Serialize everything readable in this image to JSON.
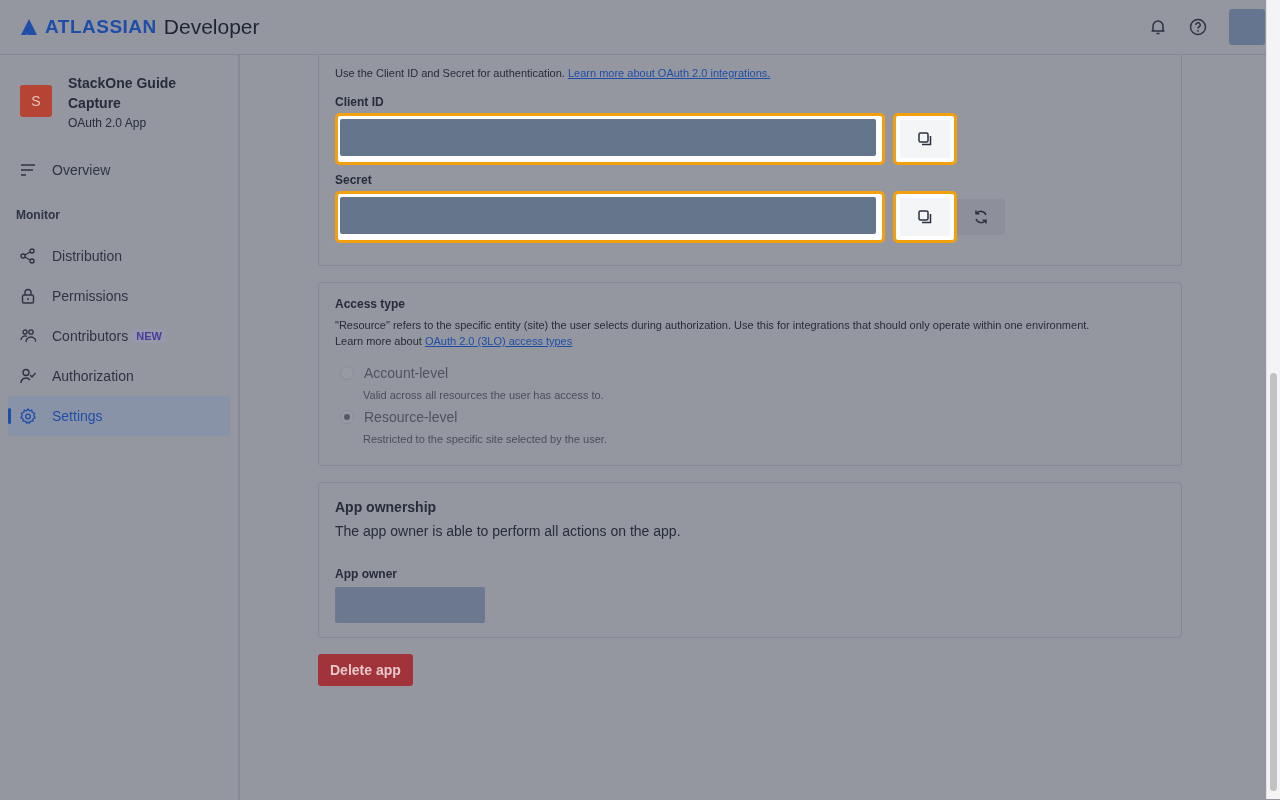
{
  "header": {
    "brand": "ATLASSIAN",
    "product": "Developer"
  },
  "app": {
    "initial": "S",
    "name": "StackOne Guide Capture",
    "type": "OAuth 2.0 App"
  },
  "nav": [
    {
      "kind": "item",
      "label": "Overview",
      "selected": false
    },
    {
      "kind": "heading",
      "label": "Monitor"
    },
    {
      "kind": "item",
      "label": "Distribution",
      "selected": false
    },
    {
      "kind": "item",
      "label": "Permissions",
      "selected": false
    },
    {
      "kind": "item",
      "label": "Contributors",
      "badge": "NEW",
      "selected": false
    },
    {
      "kind": "item",
      "label": "Authorization",
      "selected": false
    },
    {
      "kind": "item",
      "label": "Settings",
      "selected": true
    }
  ],
  "auth": {
    "description": "Use the Client ID and Secret for authentication.",
    "link": "Learn more about OAuth 2.0 integrations.",
    "fields": [
      {
        "label": "Client ID",
        "refresh": false
      },
      {
        "label": "Secret",
        "refresh": true
      }
    ]
  },
  "access": {
    "title": "Access type",
    "description": "\"Resource\" refers to the specific entity (site) the user selects during authorization. Use this for integrations that should only operate within one environment.",
    "link_prefix": "Learn more about",
    "link": "OAuth 2.0 (3LO) access types",
    "options": [
      {
        "label": "Account-level",
        "hint": "Valid across all resources the user has access to.",
        "selected": false,
        "disabled": true
      },
      {
        "label": "Resource-level",
        "hint": "Restricted to the specific site selected by the user.",
        "selected": true,
        "disabled": true
      }
    ]
  },
  "ownership": {
    "title": "App ownership",
    "description": "The app owner is able to perform all actions on the app.",
    "owner_label": "App owner"
  },
  "delete_button": "Delete app"
}
